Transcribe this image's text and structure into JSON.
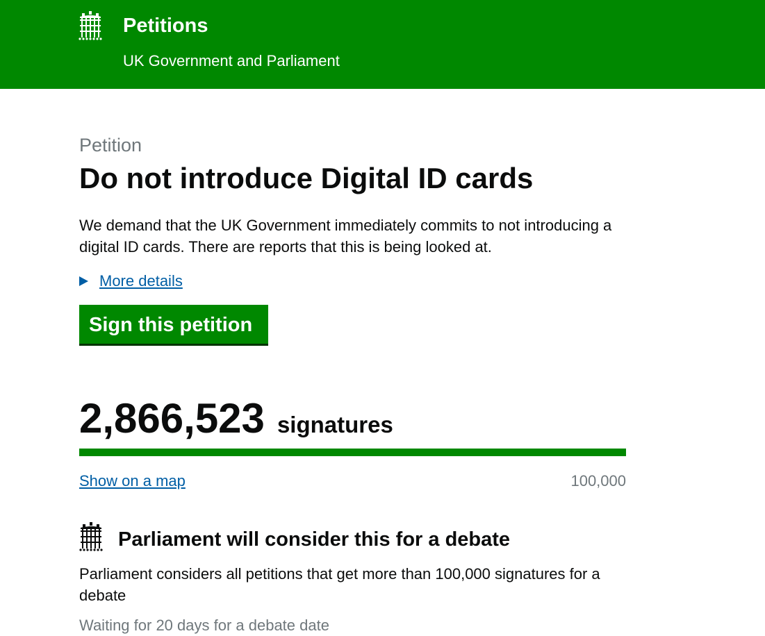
{
  "header": {
    "title": "Petitions",
    "subtitle": "UK Government and Parliament",
    "logo_icon": "portcullis-icon",
    "background_color": "#008800"
  },
  "petition": {
    "kicker": "Petition",
    "title": "Do not introduce Digital ID cards",
    "summary": "We demand that the UK Government immediately commits to not introducing a digital ID cards. There are reports that this is being looked at.",
    "details_label": "More details",
    "sign_button_label": "Sign this petition"
  },
  "signatures": {
    "count": "2,866,523",
    "label": "signatures",
    "progress_fraction": 1.0,
    "map_link_label": "Show on a map",
    "threshold": "100,000"
  },
  "debate": {
    "icon": "portcullis-icon",
    "heading": "Parliament will consider this for a debate",
    "text": "Parliament considers all petitions that get more than 100,000 signatures for a debate",
    "status": "Waiting for 20 days for a debate date"
  },
  "colors": {
    "brand_green": "#008800",
    "link_blue": "#005ea5",
    "secondary_text": "#6f777b",
    "text": "#0b0c0c"
  }
}
